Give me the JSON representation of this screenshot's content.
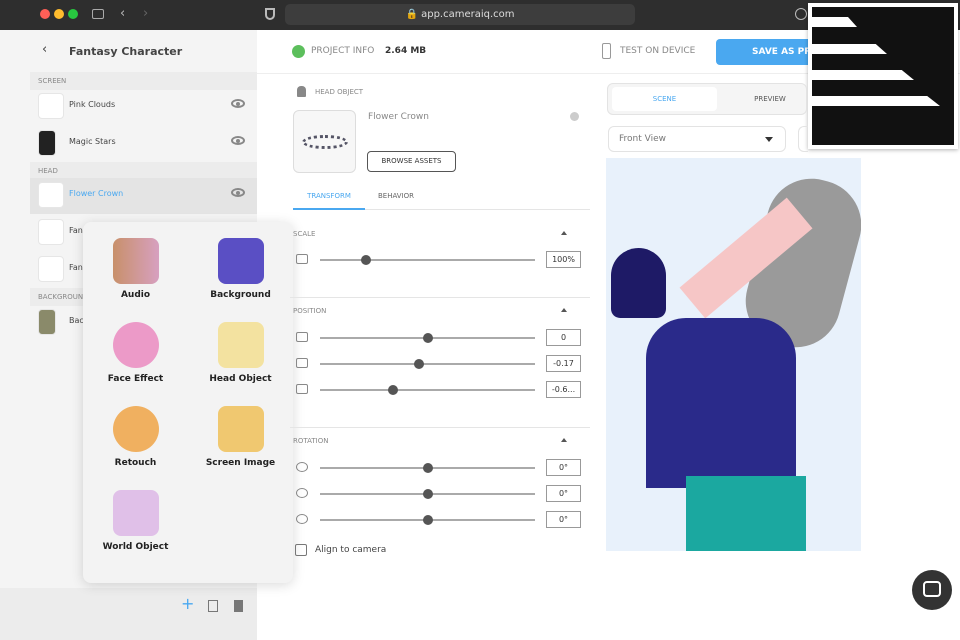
{
  "browser": {
    "url": "app.cameraiq.com"
  },
  "sidebar": {
    "title": "Fantasy Character",
    "sections": {
      "screen": "SCREEN",
      "head": "HEAD",
      "background": "BACKGROUND"
    },
    "items": [
      {
        "label": "Pink Clouds"
      },
      {
        "label": "Magic Stars"
      },
      {
        "label": "Flower Crown",
        "selected": true
      },
      {
        "label": "Fan"
      },
      {
        "label": "Fan"
      },
      {
        "label": "Bac"
      }
    ]
  },
  "add_menu": {
    "items": [
      {
        "label": "Audio"
      },
      {
        "label": "Background"
      },
      {
        "label": "Face Effect"
      },
      {
        "label": "Head Object"
      },
      {
        "label": "Retouch"
      },
      {
        "label": "Screen Image"
      },
      {
        "label": "World Object"
      }
    ]
  },
  "topbar": {
    "project_info": "PROJECT INFO",
    "size": "2.64 MB",
    "test_device": "TEST ON DEVICE",
    "save": "SAVE AS PR"
  },
  "props": {
    "section": "HEAD OBJECT",
    "asset_name": "Flower Crown",
    "browse": "BROWSE ASSETS",
    "tabs": [
      {
        "label": "TRANSFORM",
        "active": true
      },
      {
        "label": "BEHAVIOR"
      }
    ],
    "scale": {
      "label": "SCALE",
      "value": "100%",
      "slider": 0.2
    },
    "position": {
      "label": "POSITION",
      "x": "0",
      "y": "-0.17",
      "z": "-0.6...",
      "sliders": [
        0.5,
        0.46,
        0.33
      ]
    },
    "rotation": {
      "label": "ROTATION",
      "x": "0°",
      "y": "0°",
      "z": "0°",
      "sliders": [
        0.5,
        0.5,
        0.5
      ]
    },
    "align": "Align to camera",
    "align_checked": false
  },
  "viewer": {
    "tabs": [
      {
        "label": "SCENE",
        "active": true
      },
      {
        "label": "PREVIEW"
      }
    ],
    "view": "Front View"
  },
  "colors": {
    "accent": "#4aa8f0",
    "status": "#5cbf5c"
  }
}
